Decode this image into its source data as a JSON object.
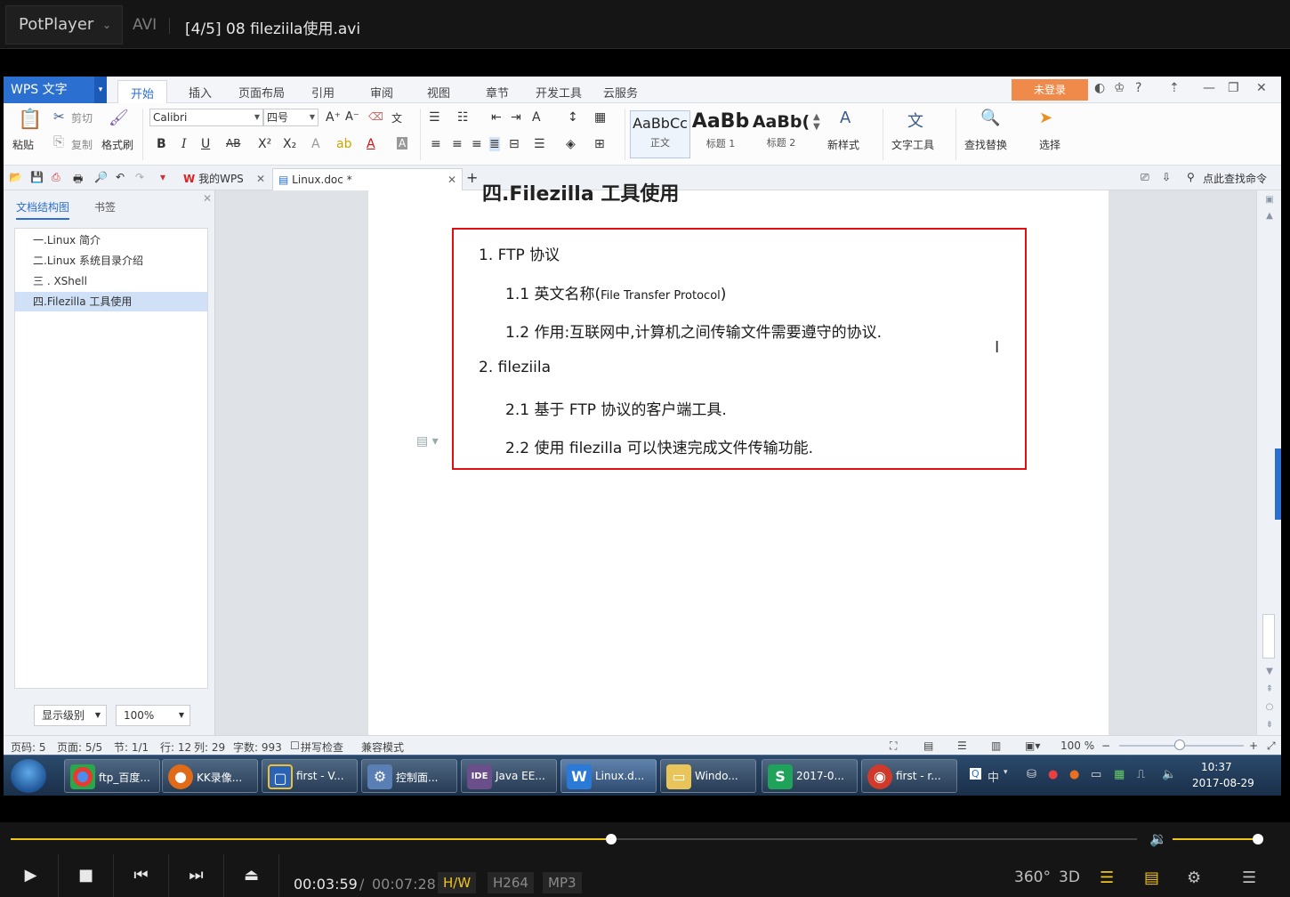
{
  "potplayer": {
    "brand": "PotPlayer",
    "format": "AVI",
    "title": "[4/5] 08 fileziila使用.avi",
    "time_current": "00:03:59",
    "time_separator": "/",
    "time_total": "00:07:28",
    "badges": [
      "H/W",
      "H264",
      "MP3"
    ],
    "progress_fraction": 0.533,
    "volume_fraction": 1.0,
    "controls": [
      "play-icon",
      "stop-icon",
      "previous-icon",
      "next-icon",
      "eject-icon"
    ],
    "right_controls": [
      "360°",
      "3D",
      "playlist-search-icon",
      "subtitle-icon",
      "gear-icon",
      "menu-icon"
    ]
  },
  "wps": {
    "logo": "WPS 文字",
    "ribbon_tabs": [
      "开始",
      "插入",
      "页面布局",
      "引用",
      "审阅",
      "视图",
      "章节",
      "开发工具",
      "云服务"
    ],
    "active_tab": "开始",
    "login": "未登录",
    "ribbon": {
      "paste": "粘贴",
      "cut": "剪切",
      "copy": "复制",
      "format_painter": "格式刷",
      "font_name": "Calibri",
      "font_size": "四号",
      "styles": [
        {
          "preview": "AaBbCc",
          "name": "正文"
        },
        {
          "preview": "AaBb",
          "name": "标题 1"
        },
        {
          "preview": "AaBb(",
          "name": "标题 2"
        }
      ],
      "new_style": "新样式",
      "text_tools": "文字工具",
      "find_replace": "查找替换",
      "select": "选择"
    },
    "doc_tabs": [
      {
        "label": "我的WPS"
      },
      {
        "label": "Linux.doc *"
      }
    ],
    "search_cmd": "点此查找命令",
    "nav": {
      "tab_outline": "文档结构图",
      "tab_bookmark": "书签",
      "items": [
        "一.Linux 简介",
        "二.Linux 系统目录介绍",
        "三 . XShell",
        "四.Filezilla 工具使用"
      ],
      "level_label": "显示级别",
      "zoom_value": "100%"
    },
    "document": {
      "heading": "四.Filezilla 工具使用",
      "lines": [
        {
          "num": "1.",
          "text": "FTP 协议"
        },
        {
          "num": "1.1",
          "text": "英文名称(",
          "small": "File Transfer Protocol",
          "tail": ")"
        },
        {
          "num": "1.2",
          "text": "作用:互联网中,计算机之间传输文件需要遵守的协议."
        },
        {
          "num": "2.",
          "text": "fileziila"
        },
        {
          "num": "2.1",
          "text": "基于 FTP 协议的客户端工具."
        },
        {
          "num": "2.2",
          "text": "使用 filezilla 可以快速完成文件传输功能."
        }
      ]
    },
    "status": {
      "page_no": "页码: 5",
      "page": "页面: 5/5",
      "section": "节: 1/1",
      "row": "行: 12",
      "col": "列: 29",
      "words": "字数: 993",
      "spell": "拼写检查",
      "compat": "兼容模式",
      "zoom": "100 %"
    }
  },
  "taskbar": {
    "items": [
      {
        "icon": "chrome-icon",
        "label": "ftp_百度..."
      },
      {
        "icon": "kk-recorder-icon",
        "label": "KK录像..."
      },
      {
        "icon": "virtualbox-icon",
        "label": "first - V..."
      },
      {
        "icon": "control-panel-icon",
        "label": "控制面..."
      },
      {
        "icon": "java-ee-icon",
        "label": "Java EE..."
      },
      {
        "icon": "wps-writer-icon",
        "label": "Linux.d..."
      },
      {
        "icon": "folder-icon",
        "label": "Windo..."
      },
      {
        "icon": "wps-sheet-icon",
        "label": "2017-0..."
      },
      {
        "icon": "terminal-icon",
        "label": "first - r..."
      }
    ],
    "ime": "中",
    "time": "10:37",
    "date": "2017-08-29"
  }
}
